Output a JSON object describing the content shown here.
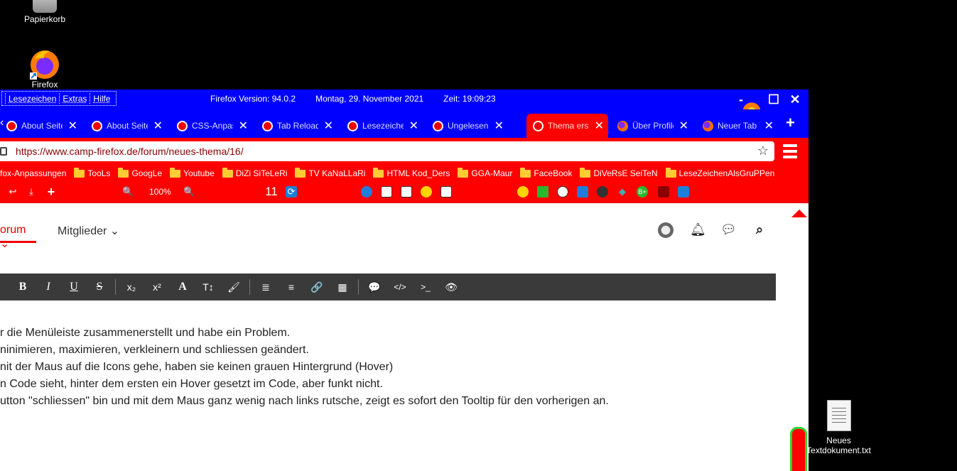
{
  "desktop": {
    "recycle_bin": "Papierkorb",
    "firefox": "Firefox",
    "textdoc_line1": "Neues",
    "textdoc_line2": "Textdokument.txt"
  },
  "titlebar": {
    "menu": [
      "Lesezeichen",
      "Extras",
      "Hilfe"
    ],
    "version": "Firefox Version: 94.0.2",
    "date": "Montag, 29. November 2021",
    "time": "Zeit:  19:09:23",
    "minimize": "-",
    "maximize": "☐",
    "close": "✕"
  },
  "tabs": [
    {
      "title": "About Seiten",
      "active": false
    },
    {
      "title": "About Seiten",
      "active": false
    },
    {
      "title": "CSS-Anpassungen",
      "active": false
    },
    {
      "title": "Tab Reload",
      "active": false
    },
    {
      "title": "Lesezeichen",
      "active": false
    },
    {
      "title": "Ungelesen",
      "active": false
    },
    {
      "title": "Thema erstellen",
      "active": true
    },
    {
      "title": "Über Profile",
      "active": false
    },
    {
      "title": "Neuer Tab",
      "active": false
    }
  ],
  "new_tab": "+",
  "url": "https://www.camp-firefox.de/forum/neues-thema/16/",
  "bookmarks": [
    {
      "label": "fox-Anpassungen",
      "folder": false
    },
    {
      "label": "TooLs",
      "folder": true
    },
    {
      "label": "GoogLe",
      "folder": true
    },
    {
      "label": "Youtube",
      "folder": true
    },
    {
      "label": "DiZi SiTeLeRi",
      "folder": true
    },
    {
      "label": "TV KaNaLLaRi",
      "folder": true
    },
    {
      "label": "HTML Kod_Ders",
      "folder": true
    },
    {
      "label": "GGA-Maur",
      "folder": true
    },
    {
      "label": "FaceBook",
      "folder": true
    },
    {
      "label": "DiVeRsE SeiTeN",
      "folder": true
    },
    {
      "label": "LeseZeichenAlsGruPPen",
      "folder": true
    }
  ],
  "toolbar2": {
    "zoom": "100%",
    "counter": "11"
  },
  "forum_nav": {
    "forum": "orum ⌄",
    "members": "Mitglieder ⌄"
  },
  "editor_buttons": [
    "B",
    "I",
    "U",
    "S",
    "x₂",
    "x²",
    "A",
    "T↕",
    "🖌",
    "≣",
    "≡",
    "🔗",
    "▦",
    "💬",
    "</>",
    ">_",
    "👁"
  ],
  "body_lines": [
    "r die Menüleiste zusammenerstellt und habe ein Problem.",
    "ninimieren, maximieren, verkleinern und schliessen geändert.",
    "nit der Maus auf die Icons gehe, haben sie keinen grauen Hintergrund (Hover)",
    "n Code sieht, hinter dem ersten ein Hover gesetzt im Code, aber funkt nicht.",
    "utton \"schliessen\" bin und mit dem Maus ganz wenig nach links rutsche, zeigt es sofort den Tooltip für den vorherigen an."
  ],
  "colors": {
    "titlebar": "#0000ff",
    "toolbar": "#ff0000",
    "accent": "#ee0000",
    "scroll_border": "#2bd62b"
  }
}
